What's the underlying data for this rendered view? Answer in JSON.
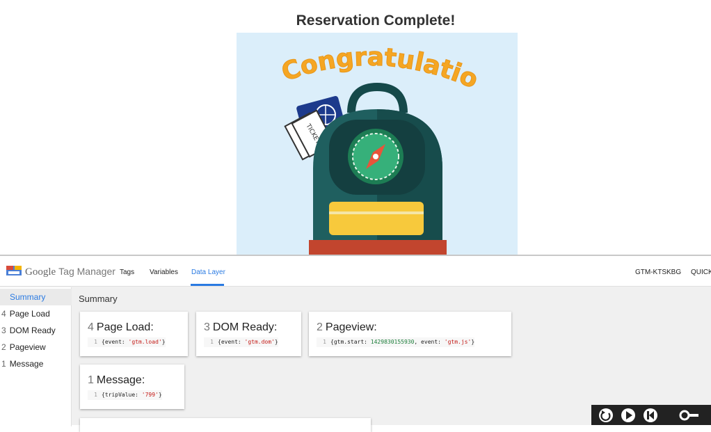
{
  "page": {
    "heading": "Reservation Complete!",
    "hero_text": "Congratulations!",
    "ticket_text": "TICKET"
  },
  "gtm": {
    "brand_google": "Google",
    "brand_product": "Tag Manager",
    "nav": [
      "Tags",
      "Variables",
      "Data Layer"
    ],
    "active_tab": "Data Layer",
    "container_id": "GTM-KTSKBG",
    "quick_label": "QUICK",
    "sidebar": {
      "summary": "Summary",
      "items": [
        {
          "num": "4",
          "label": "Page Load"
        },
        {
          "num": "3",
          "label": "DOM Ready"
        },
        {
          "num": "2",
          "label": "Pageview"
        },
        {
          "num": "1",
          "label": "Message"
        }
      ]
    },
    "main_title": "Summary",
    "cards": [
      {
        "num": "4",
        "title": "Page Load:",
        "line": "1",
        "code_prefix": "{event: ",
        "code_str": "'gtm.load'",
        "code_suffix": "}"
      },
      {
        "num": "3",
        "title": "DOM Ready:",
        "line": "1",
        "code_prefix": "{event: ",
        "code_str": "'gtm.dom'",
        "code_suffix": "}"
      },
      {
        "num": "2",
        "title": "Pageview:",
        "line": "1",
        "code_prefix": "{gtm.start: ",
        "code_num": "1429830155930",
        "code_mid": ", event: ",
        "code_str": "'gtm.js'",
        "code_suffix": "}"
      },
      {
        "num": "1",
        "title": "Message:",
        "line": "1",
        "code_prefix": "{tripValue: ",
        "code_str": "'799'",
        "code_suffix": "}"
      }
    ]
  },
  "colors": {
    "accent": "#2a7ae2",
    "hero_bg": "#dbeefa",
    "congrats": "#f5a623",
    "backpack": "#1f5f5f"
  },
  "icons": [
    "gtm-logo-icon",
    "replay-icon",
    "play-icon",
    "skip-back-icon",
    "key-icon"
  ]
}
